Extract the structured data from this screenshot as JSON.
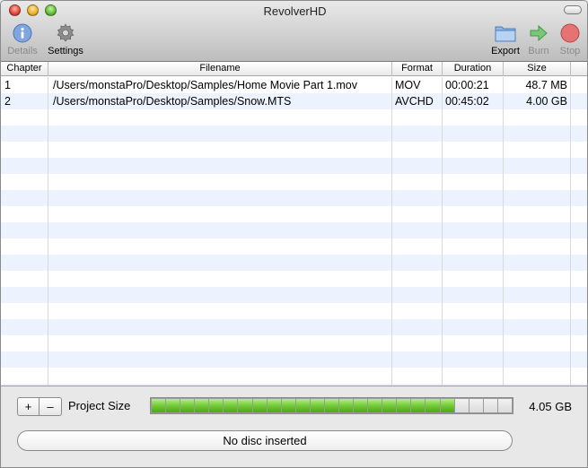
{
  "window": {
    "title": "RevolverHD"
  },
  "toolbar": {
    "details_label": "Details",
    "settings_label": "Settings",
    "export_label": "Export",
    "burn_label": "Burn",
    "stop_label": "Stop"
  },
  "table": {
    "columns": {
      "chapter": "Chapter",
      "filename": "Filename",
      "format": "Format",
      "duration": "Duration",
      "size": "Size"
    },
    "rows": [
      {
        "chapter": "1",
        "filename": "/Users/monstaPro/Desktop/Samples/Home Movie Part 1.mov",
        "format": "MOV",
        "duration": "00:00:21",
        "size": "48.7 MB"
      },
      {
        "chapter": "2",
        "filename": "/Users/monstaPro/Desktop/Samples/Snow.MTS",
        "format": "AVCHD",
        "duration": "00:45:02",
        "size": "4.00 GB"
      }
    ]
  },
  "footer": {
    "add_label": "+",
    "remove_label": "–",
    "project_size_label": "Project Size",
    "project_size_value": "4.05 GB",
    "meter_fraction": 0.84,
    "disc_status": "No disc inserted"
  },
  "icons": {
    "details": "info-icon",
    "settings": "gear-icon",
    "export": "folder-icon",
    "burn": "arrow-right-icon",
    "stop": "stop-icon"
  },
  "colors": {
    "meter_fill": "#6cc82e",
    "row_stripe": "#edf3fe",
    "stop_red": "#e05a5a",
    "burn_green": "#5cb85c",
    "details_blue": "#3d7bd9"
  }
}
